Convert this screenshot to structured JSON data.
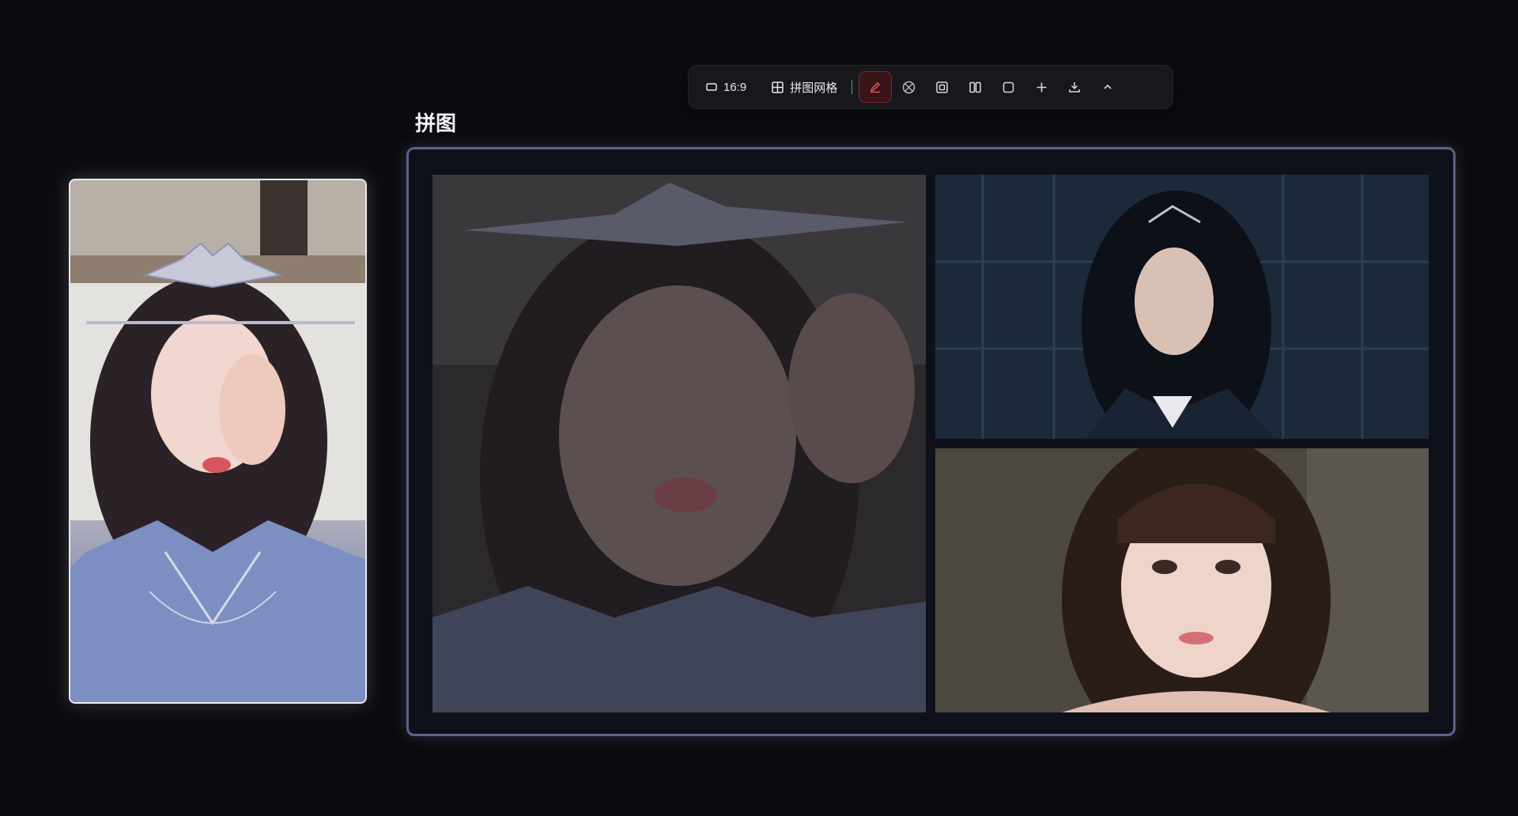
{
  "toolbar": {
    "aspect_label": "16:9",
    "grid_label": "拼图网格",
    "icons": [
      "aspect-icon",
      "grid-icon",
      "pen-icon",
      "no-fill-icon",
      "frame-icon",
      "columns-icon",
      "square-icon",
      "plus-icon",
      "download-icon",
      "chevron-up-icon"
    ],
    "active_tool": "pen",
    "accent": "#ef5a66"
  },
  "section": {
    "title": "拼图"
  },
  "canvas": {
    "border_color": "#5d6289",
    "cells": 3
  }
}
